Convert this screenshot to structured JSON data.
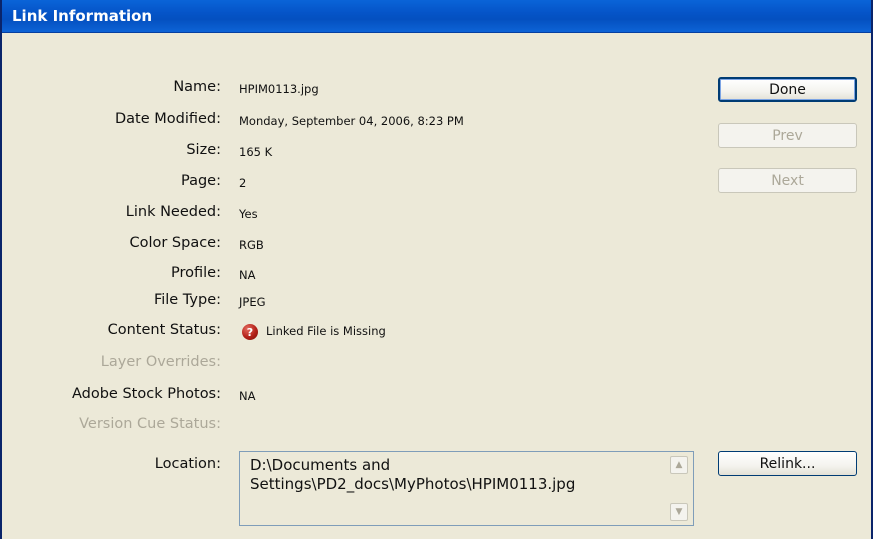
{
  "window": {
    "title": "Link Information"
  },
  "fields": {
    "name": {
      "label": "Name:",
      "value": "HPIM0113.jpg"
    },
    "date_modified": {
      "label": "Date Modified:",
      "value": "Monday, September 04, 2006, 8:23 PM"
    },
    "size": {
      "label": "Size:",
      "value": "165 K"
    },
    "page": {
      "label": "Page:",
      "value": "2"
    },
    "link_needed": {
      "label": "Link Needed:",
      "value": "Yes"
    },
    "color_space": {
      "label": "Color Space:",
      "value": "RGB"
    },
    "profile": {
      "label": "Profile:",
      "value": "NA"
    },
    "file_type": {
      "label": "File Type:",
      "value": "JPEG"
    },
    "content_status": {
      "label": "Content Status:",
      "value": "Linked File is Missing",
      "icon": "missing-link-icon",
      "icon_color": "#b32018"
    },
    "layer_overrides": {
      "label": "Layer Overrides:",
      "value": ""
    },
    "adobe_stock": {
      "label": "Adobe Stock Photos:",
      "value": "NA"
    },
    "version_cue": {
      "label": "Version Cue Status:",
      "value": ""
    },
    "location": {
      "label": "Location:",
      "value": "D:\\Documents and Settings\\PD2_docs\\MyPhotos\\HPIM0113.jpg"
    }
  },
  "buttons": {
    "done": "Done",
    "prev": "Prev",
    "next": "Next",
    "relink": "Relink..."
  },
  "colors": {
    "titlebar": "#0554c8",
    "dialog_bg": "#ece9d8",
    "disabled_text": "#aca899"
  }
}
